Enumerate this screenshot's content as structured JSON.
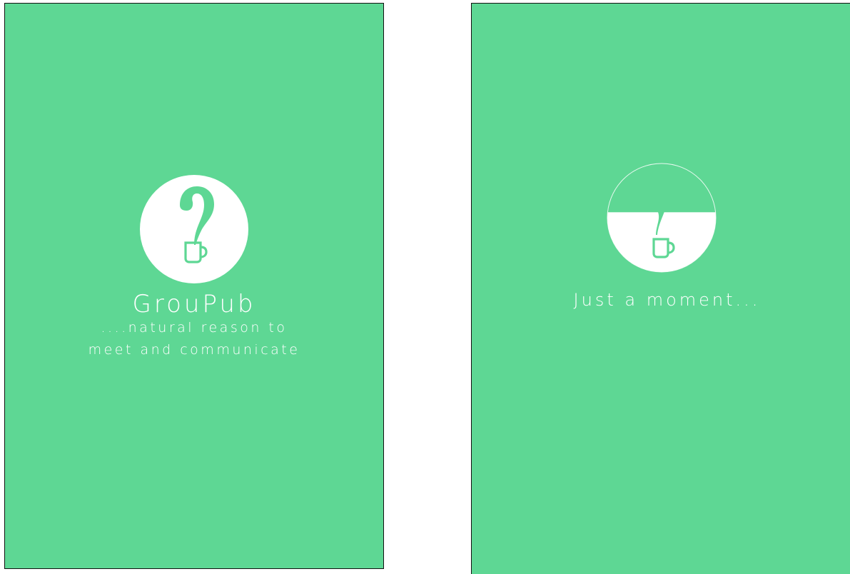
{
  "theme": {
    "accent": "#5ed794",
    "foreground": "#ffffff"
  },
  "splash": {
    "logo_icon": "question-mark-mug-icon",
    "app_name": "GrouPub",
    "tagline_line1": "....natural reason to",
    "tagline_line2": "meet and communicate"
  },
  "loading": {
    "logo_icon": "question-mark-mug-icon",
    "fill_level": 0.55,
    "message": "Just a moment..."
  }
}
